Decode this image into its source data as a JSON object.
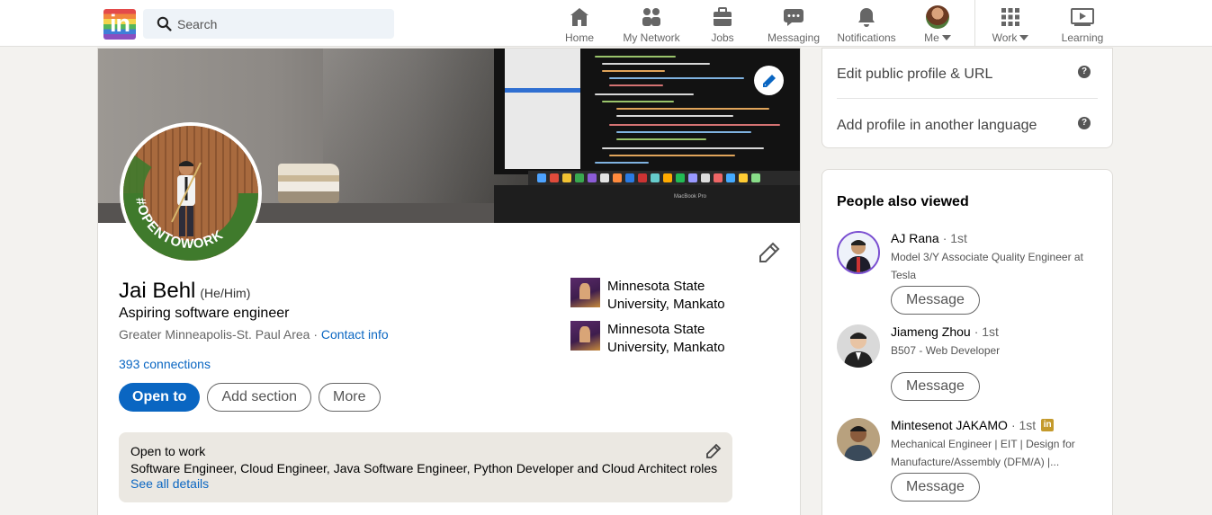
{
  "nav": {
    "search_placeholder": "Search",
    "items": [
      {
        "label": "Home",
        "icon": "home-icon"
      },
      {
        "label": "My Network",
        "icon": "network-icon"
      },
      {
        "label": "Jobs",
        "icon": "briefcase-icon"
      },
      {
        "label": "Messaging",
        "icon": "messaging-icon"
      },
      {
        "label": "Notifications",
        "icon": "bell-icon"
      },
      {
        "label": "Me",
        "icon": "avatar"
      },
      {
        "label": "Work",
        "icon": "grid-icon"
      },
      {
        "label": "Learning",
        "icon": "learning-icon"
      }
    ]
  },
  "profile": {
    "name": "Jai Behl",
    "pronouns": "(He/Him)",
    "headline": "Aspiring software engineer",
    "location": "Greater Minneapolis-St. Paul Area",
    "separator": " · ",
    "contact_info": "Contact info",
    "connections": "393 connections",
    "photo_frame_text": "#OPENTOWORK",
    "education": [
      {
        "name": "Minnesota State University, Mankato"
      },
      {
        "name": "Minnesota State University, Mankato"
      }
    ],
    "buttons": {
      "open_to": "Open to",
      "add_section": "Add section",
      "more": "More"
    },
    "open_to_work": {
      "title": "Open to work",
      "roles": "Software Engineer, Cloud Engineer, Java Software Engineer, Python Developer and Cloud Architect roles",
      "see_all": "See all details"
    }
  },
  "sidebar": {
    "links": [
      {
        "label": "Edit public profile & URL"
      },
      {
        "label": "Add profile in another language"
      }
    ],
    "people_also_viewed": {
      "title": "People also viewed",
      "people": [
        {
          "name": "AJ Rana",
          "degree": "· 1st",
          "subtitle": "Model 3/Y Associate Quality Engineer at Tesla",
          "button": "Message"
        },
        {
          "name": "Jiameng Zhou",
          "degree": "· 1st",
          "subtitle": "B507 - Web Developer",
          "button": "Message"
        },
        {
          "name": "Mintesenot JAKAMO",
          "degree": "· 1st",
          "subtitle": "Mechanical Engineer | EIT | Design for Manufacture/Assembly (DFM/A) |...",
          "button": "Message",
          "badge": "in"
        }
      ]
    }
  },
  "colors": {
    "accent": "#0a66c2",
    "page_bg": "#f3f2ef",
    "open_to_work_green": "#3f7a2c"
  }
}
